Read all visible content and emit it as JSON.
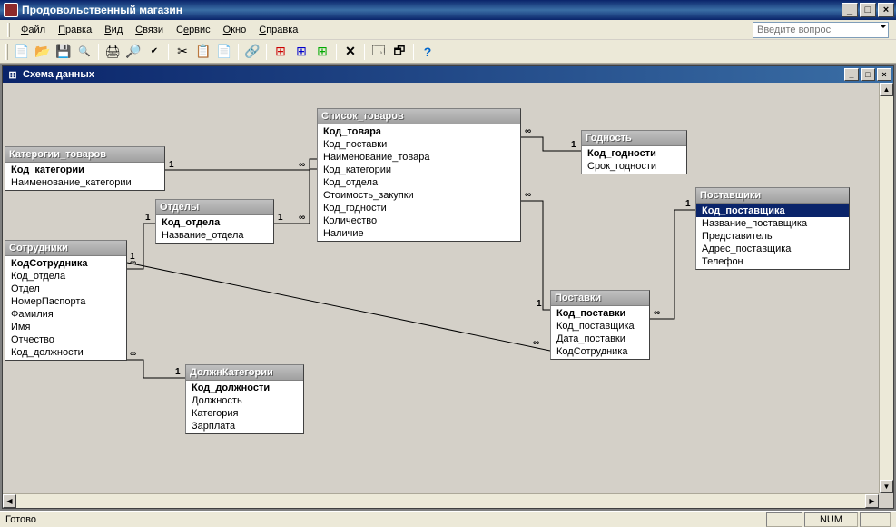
{
  "app": {
    "title": "Продовольственный магазин"
  },
  "menu": {
    "file": "Файл",
    "edit": "Правка",
    "view": "Вид",
    "relations": "Связи",
    "service": "Сервис",
    "window": "Окно",
    "help": "Справка",
    "help_placeholder": "Введите вопрос"
  },
  "mdi": {
    "title": "Схема данных"
  },
  "tables": {
    "categories": {
      "title": "Катерогии_товаров",
      "f0": "Код_категории",
      "f1": "Наименование_категории"
    },
    "departments": {
      "title": "Отделы",
      "f0": "Код_отдела",
      "f1": "Название_отдела"
    },
    "employees": {
      "title": "Сотрудники",
      "f0": "КодСотрудника",
      "f1": "Код_отдела",
      "f2": "Отдел",
      "f3": "НомерПаспорта",
      "f4": "Фамилия",
      "f5": "Имя",
      "f6": "Отчество",
      "f7": "Код_должности"
    },
    "position_cat": {
      "title": "ДолжнКатегории",
      "f0": "Код_должности",
      "f1": "Должность",
      "f2": "Категория",
      "f3": "Зарплата"
    },
    "goods": {
      "title": "Список_товаров",
      "f0": "Код_товара",
      "f1": "Код_поставки",
      "f2": "Наименование_товара",
      "f3": "Код_категории",
      "f4": "Код_отдела",
      "f5": "Стоимость_закупки",
      "f6": "Код_годности",
      "f7": "Количество",
      "f8": "Наличие"
    },
    "validity": {
      "title": "Годность",
      "f0": "Код_годности",
      "f1": "Срок_годности"
    },
    "deliveries": {
      "title": "Поставки",
      "f0": "Код_поставки",
      "f1": "Код_поставщика",
      "f2": "Дата_поставки",
      "f3": "КодСотрудника"
    },
    "suppliers": {
      "title": "Поставщики",
      "f0": "Код_поставщика",
      "f1": "Название_поставщика",
      "f2": "Представитель",
      "f3": "Адрес_поставщика",
      "f4": "Телефон"
    }
  },
  "rel": {
    "one": "1",
    "many": "∞"
  },
  "status": {
    "ready": "Готово",
    "num": "NUM"
  }
}
